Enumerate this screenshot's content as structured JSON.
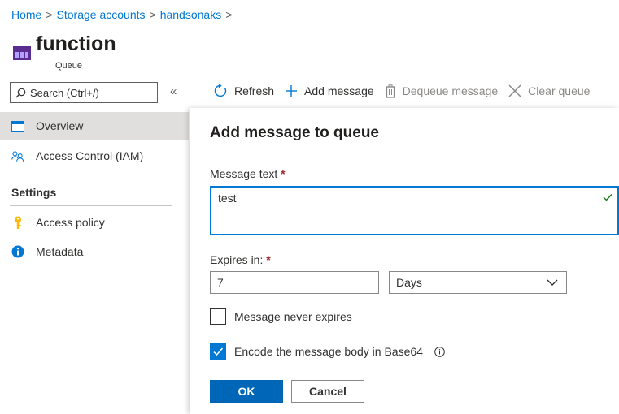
{
  "breadcrumb": {
    "items": [
      "Home",
      "Storage accounts",
      "handsonaks"
    ],
    "separator": ">"
  },
  "header": {
    "title": "function",
    "subtitle": "Queue",
    "icon": "queue-icon"
  },
  "search": {
    "placeholder": "Search (Ctrl+/)"
  },
  "collapse_label": "«",
  "toolbar": {
    "refresh": "Refresh",
    "add_message": "Add message",
    "dequeue_message": "Dequeue message",
    "clear_queue": "Clear queue"
  },
  "sidebar": {
    "items": [
      {
        "label": "Overview",
        "icon": "overview-icon",
        "selected": true
      },
      {
        "label": "Access Control (IAM)",
        "icon": "iam-people-icon"
      }
    ],
    "settings_heading": "Settings",
    "settings_items": [
      {
        "label": "Access policy",
        "icon": "key-icon"
      },
      {
        "label": "Metadata",
        "icon": "info-icon"
      }
    ]
  },
  "panel": {
    "title": "Add message to queue",
    "message_text_label": "Message text",
    "required_marker": "*",
    "message_text_value": "test",
    "expires_label": "Expires in:",
    "expires_value": "7",
    "expires_unit": "Days",
    "never_expires_label": "Message never expires",
    "never_expires_checked": false,
    "encode_label": "Encode the message body in Base64",
    "encode_checked": true,
    "ok_label": "OK",
    "cancel_label": "Cancel"
  },
  "colors": {
    "accent": "#0078d4",
    "primary_button": "#0067b8",
    "required": "#a4262c",
    "valid": "#107c10",
    "selected_nav": "#e1dfdd"
  }
}
